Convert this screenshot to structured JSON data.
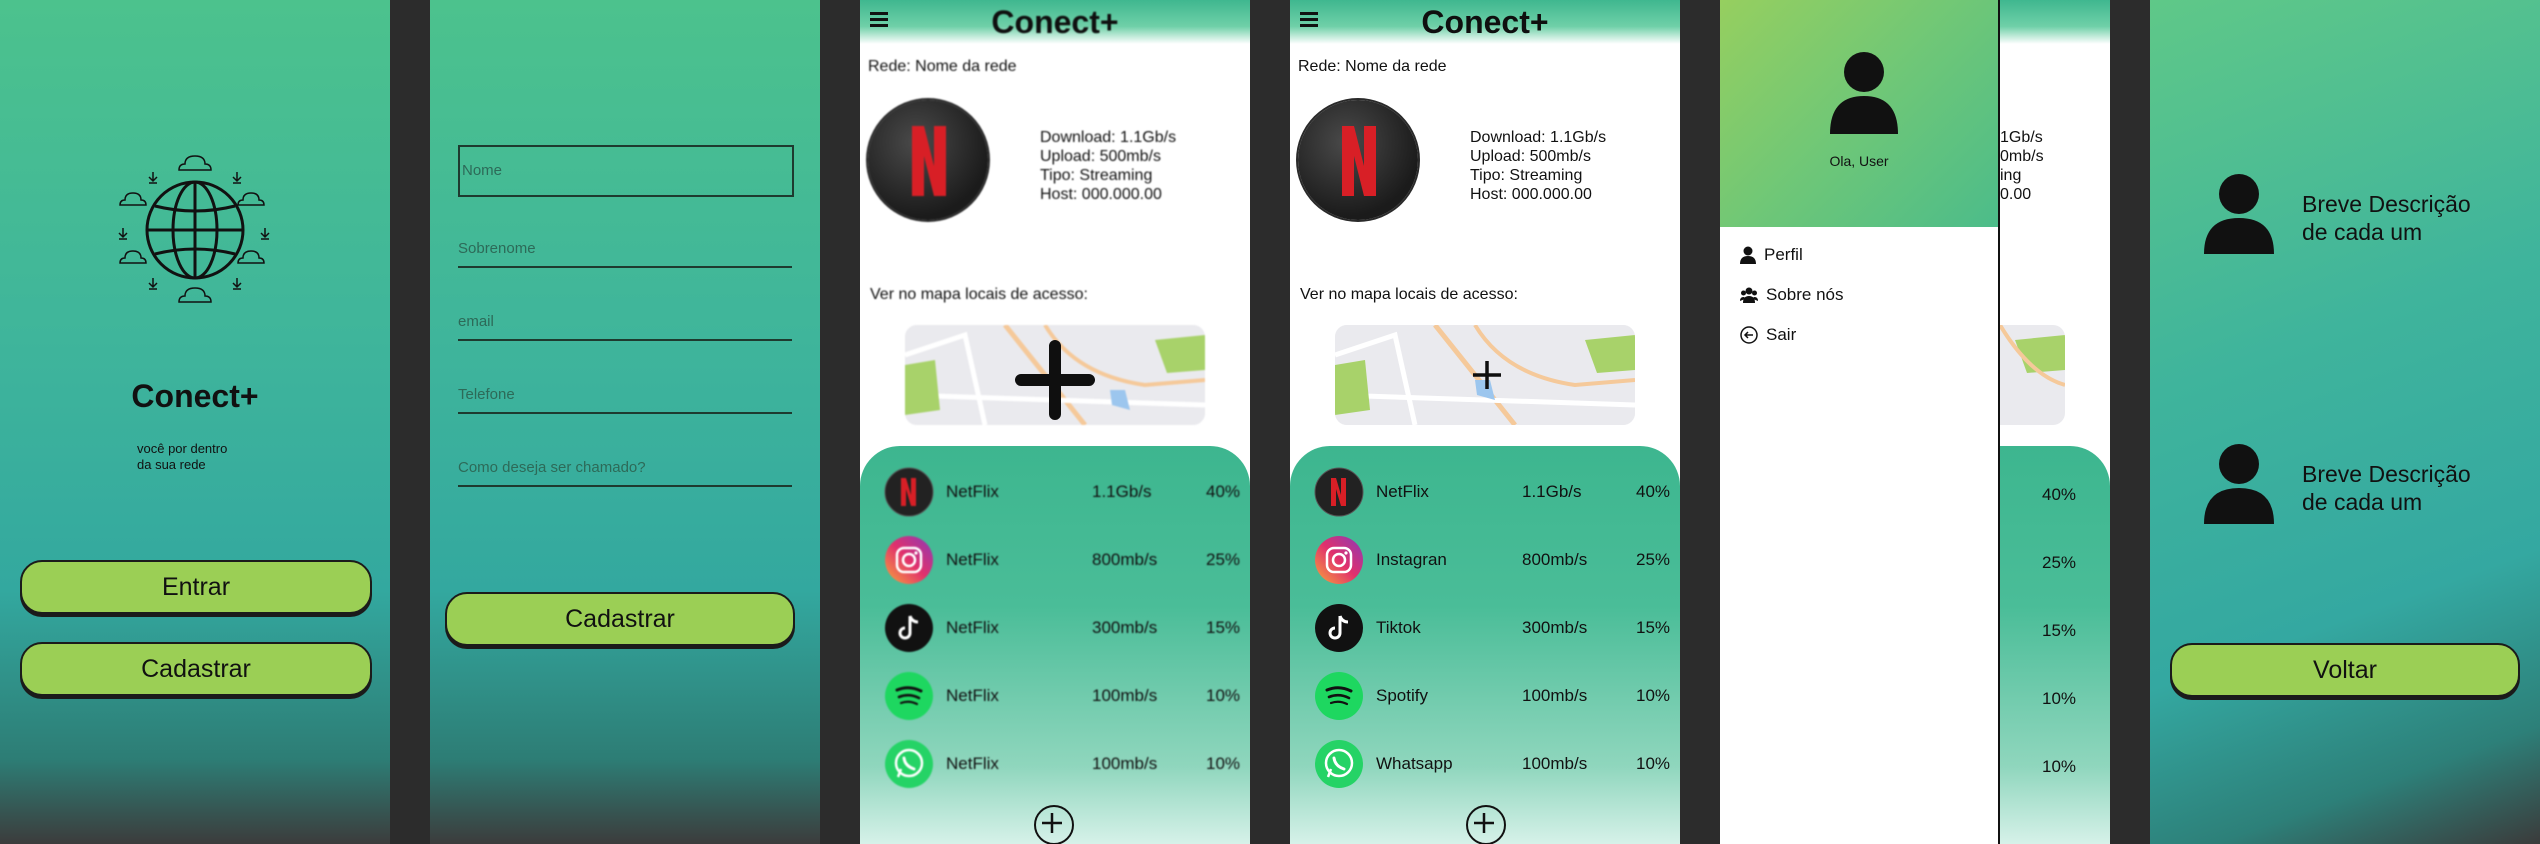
{
  "screen1": {
    "app_name": "Conect+",
    "tagline_line1": "você por dentro",
    "tagline_line2": "da sua rede",
    "enter_label": "Entrar",
    "register_label": "Cadastrar",
    "logo_icon": "globe-cloud-download-icon"
  },
  "screen2": {
    "fields": [
      {
        "placeholder": "Nome"
      },
      {
        "placeholder": "Sobrenome"
      },
      {
        "placeholder": "email"
      },
      {
        "placeholder": "Telefone"
      },
      {
        "placeholder": "Como deseja ser chamado?"
      }
    ],
    "submit_label": "Cadastrar"
  },
  "dashboard": {
    "title": "Conect+",
    "network_label": "Rede: Nome da rede",
    "download": "Download: 1.1Gb/s",
    "upload": "Upload: 500mb/s",
    "type": "Tipo: Streaming",
    "host": "Host: 000.000.00",
    "map_label": "Ver no mapa locais de acesso:",
    "blurred_apps": [
      {
        "name": "NetFlix",
        "speed": "1.1Gb/s",
        "pct": "40%",
        "icon": "netflix-icon"
      },
      {
        "name": "NetFlix",
        "speed": "800mb/s",
        "pct": "25%",
        "icon": "instagram-icon"
      },
      {
        "name": "NetFlix",
        "speed": "300mb/s",
        "pct": "15%",
        "icon": "tiktok-icon"
      },
      {
        "name": "NetFlix",
        "speed": "100mb/s",
        "pct": "10%",
        "icon": "spotify-icon"
      },
      {
        "name": "NetFlix",
        "speed": "100mb/s",
        "pct": "10%",
        "icon": "whatsapp-icon"
      }
    ],
    "apps": [
      {
        "name": "NetFlix",
        "speed": "1.1Gb/s",
        "pct": "40%",
        "icon": "netflix-icon"
      },
      {
        "name": "Instagran",
        "speed": "800mb/s",
        "pct": "25%",
        "icon": "instagram-icon"
      },
      {
        "name": "Tiktok",
        "speed": "300mb/s",
        "pct": "15%",
        "icon": "tiktok-icon"
      },
      {
        "name": "Spotify",
        "speed": "100mb/s",
        "pct": "10%",
        "icon": "spotify-icon"
      },
      {
        "name": "Whatsapp",
        "speed": "100mb/s",
        "pct": "10%",
        "icon": "whatsapp-icon"
      }
    ]
  },
  "menu": {
    "greeting": "Ola, User",
    "items": [
      {
        "label": "Perfil",
        "icon": "person-icon"
      },
      {
        "label": "Sobre nós",
        "icon": "users-icon"
      },
      {
        "label": "Sair",
        "icon": "arrow-left-circle-icon"
      }
    ],
    "peek_stats": [
      "1Gb/s",
      "0mb/s",
      "ing",
      "0.00"
    ],
    "peek_pcts": [
      "40%",
      "25%",
      "15%",
      "10%",
      "10%"
    ]
  },
  "about": {
    "items": [
      {
        "text_line1": "Breve Descrição",
        "text_line2": "de cada um"
      },
      {
        "text_line1": "Breve Descrição",
        "text_line2": "de cada um"
      }
    ],
    "back_label": "Voltar"
  },
  "colors": {
    "green_button": "#9bcf55",
    "teal": "#3fb59b",
    "dark": "#2c2c2c"
  }
}
